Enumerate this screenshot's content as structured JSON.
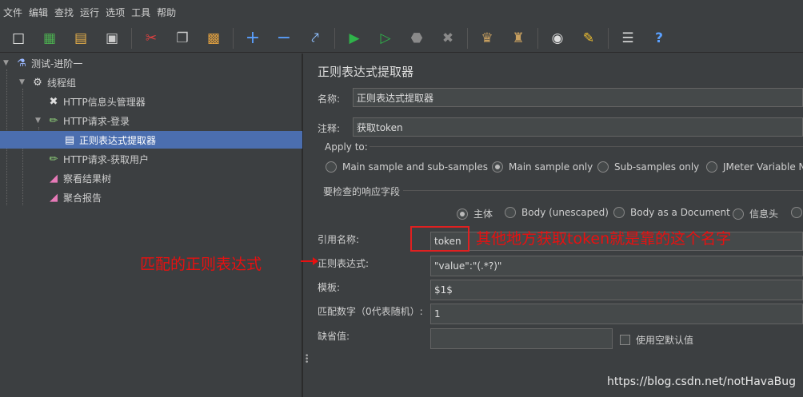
{
  "menu": [
    "文件",
    "编辑",
    "查找",
    "运行",
    "选项",
    "工具",
    "帮助"
  ],
  "toolbar_icons": [
    "new-icon",
    "templates-icon",
    "open-icon",
    "save-icon",
    "cut-icon",
    "copy-icon",
    "paste-icon",
    "expand-icon",
    "collapse-icon",
    "toggle-icon",
    "start-icon",
    "start-no-pause-icon",
    "stop-icon",
    "shutdown-icon",
    "clear-icon",
    "clear-all-icon",
    "search-icon",
    "reset-search-icon",
    "function-helper-icon",
    "help-icon"
  ],
  "tree": {
    "test_plan": "测试-进阶一",
    "thread_group": "线程组",
    "header_manager": "HTTP信息头管理器",
    "http_login": "HTTP请求-登录",
    "regex_extractor": "正则表达式提取器",
    "http_get_user": "HTTP请求-获取用户",
    "results_tree": "察看结果树",
    "aggregate_report": "聚合报告"
  },
  "panel": {
    "title": "正则表达式提取器",
    "name_label": "名称:",
    "name_value": "正则表达式提取器",
    "comment_label": "注释:",
    "comment_value": "获取token",
    "apply_to_label": "Apply to:",
    "apply_to_options": [
      "Main sample and sub-samples",
      "Main sample only",
      "Sub-samples only",
      "JMeter Variable Na"
    ],
    "apply_to_selected": 1,
    "field_label": "要检查的响应字段",
    "field_options": [
      "主体",
      "Body (unescaped)",
      "Body as a Document",
      "信息头"
    ],
    "field_selected": 0,
    "ref_name_label": "引用名称:",
    "ref_name_value": "token",
    "regex_label": "正则表达式:",
    "regex_value": "\"value\":\"(.*?)\"",
    "template_label": "模板:",
    "template_value": "$1$",
    "match_no_label": "匹配数字（0代表随机）:",
    "match_no_value": "1",
    "default_label": "缺省值:",
    "default_value": "",
    "use_empty_label": "使用空默认值"
  },
  "annotations": {
    "token_note": "其他地方获取token就是靠的这个名字",
    "regex_note": "匹配的正则表达式"
  },
  "watermark": "https://blog.csdn.net/notHavaBug",
  "colors": {
    "selection": "#4b6eaf",
    "annotation": "#e81010",
    "background": "#3c3f41"
  }
}
